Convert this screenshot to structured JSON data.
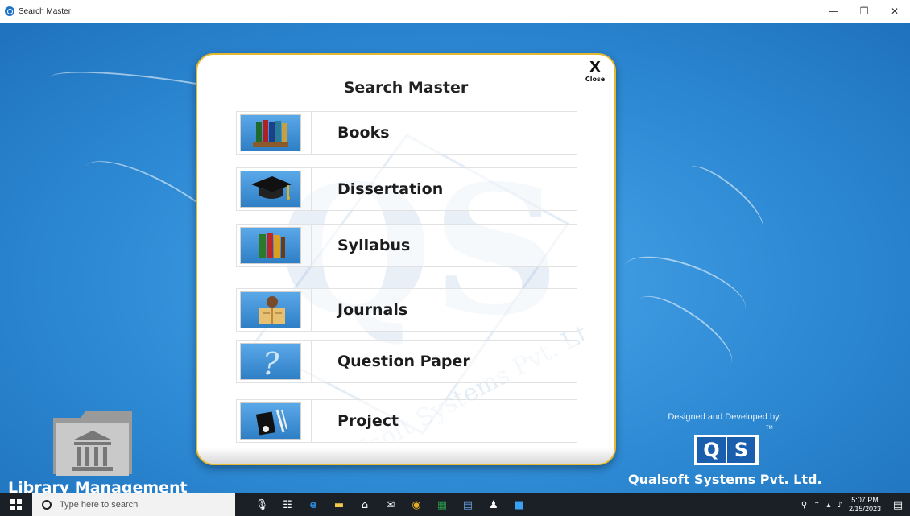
{
  "window": {
    "title": "Search Master",
    "minimize_glyph": "—",
    "restore_glyph": "❐",
    "close_glyph": "✕"
  },
  "dialog": {
    "title": "Search Master",
    "close_x": "X",
    "close_label": "Close",
    "watermark_text": "Qualsoft Systems Pvt. Ltd."
  },
  "menu": {
    "items": [
      {
        "label": "Books",
        "icon": "books-icon"
      },
      {
        "label": "Dissertation",
        "icon": "graduation-cap-icon"
      },
      {
        "label": "Syllabus",
        "icon": "syllabus-books-icon"
      },
      {
        "label": "Journals",
        "icon": "journal-reader-icon"
      },
      {
        "label": "Question Paper",
        "icon": "question-mark-icon"
      },
      {
        "label": "Project",
        "icon": "project-icon"
      }
    ]
  },
  "library": {
    "label": "Library Management",
    "icon": "library-building-icon"
  },
  "branding": {
    "designed_by": "Designed and Developed by:",
    "tm": "TM",
    "logo_q": "Q",
    "logo_s": "S",
    "company": "Qualsoft Systems Pvt. Ltd."
  },
  "taskbar": {
    "search_placeholder": "Type here to search",
    "time": "5:07 PM",
    "date": "2/15/2023"
  },
  "colors": {
    "desktop_blue": "#2f8fd8",
    "dialog_border": "#e6b830",
    "logo_blue": "#1a5fae",
    "taskbar": "#1b1f26"
  }
}
